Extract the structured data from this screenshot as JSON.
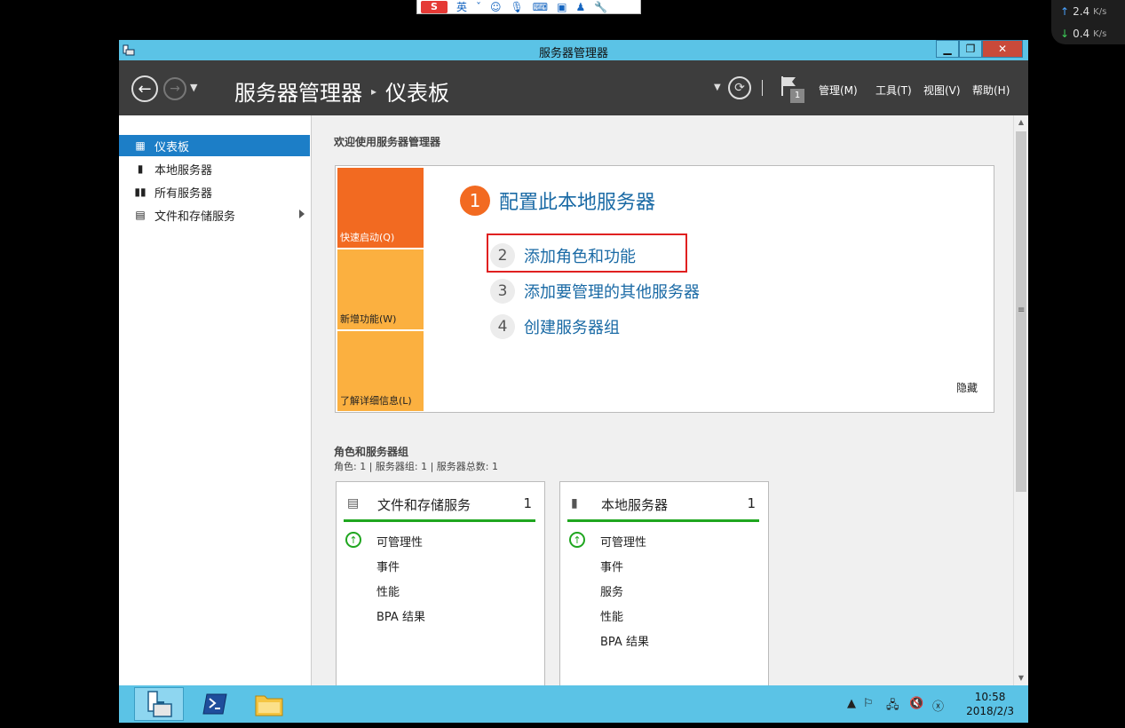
{
  "ime": {
    "label": "英",
    "logo": "S"
  },
  "netspeed": {
    "up_value": "2.4",
    "down_value": "0.4",
    "unit": "K/s"
  },
  "window": {
    "title": "服务器管理器"
  },
  "header": {
    "breadcrumb_root": "服务器管理器",
    "breadcrumb_current": "仪表板",
    "notification_count": "1",
    "menu": {
      "manage": "管理(M)",
      "tools": "工具(T)",
      "view": "视图(V)",
      "help": "帮助(H)"
    }
  },
  "sidebar": {
    "items": [
      {
        "label": "仪表板",
        "icon": "dashboard-icon"
      },
      {
        "label": "本地服务器",
        "icon": "server-icon"
      },
      {
        "label": "所有服务器",
        "icon": "servers-icon"
      },
      {
        "label": "文件和存储服务",
        "icon": "storage-icon"
      }
    ]
  },
  "welcome": {
    "title": "欢迎使用服务器管理器",
    "tiles": {
      "quickstart": "快速启动(Q)",
      "whatsnew": "新增功能(W)",
      "learnmore": "了解详细信息(L)"
    },
    "step1": {
      "num": "1",
      "label": "配置此本地服务器"
    },
    "step2": {
      "num": "2",
      "label": "添加角色和功能"
    },
    "step3": {
      "num": "3",
      "label": "添加要管理的其他服务器"
    },
    "step4": {
      "num": "4",
      "label": "创建服务器组"
    },
    "hide": "隐藏"
  },
  "roles": {
    "title": "角色和服务器组",
    "summary": "角色: 1 | 服务器组: 1 | 服务器总数: 1",
    "cards": [
      {
        "name": "文件和存储服务",
        "count": "1",
        "rows": [
          "可管理性",
          "事件",
          "性能",
          "BPA 结果"
        ]
      },
      {
        "name": "本地服务器",
        "count": "1",
        "rows": [
          "可管理性",
          "事件",
          "服务",
          "性能",
          "BPA 结果"
        ]
      }
    ]
  },
  "taskbar": {
    "time": "10:58",
    "date": "2018/2/3"
  },
  "colors": {
    "accent": "#1c7ec7",
    "orange": "#f26a21",
    "amber": "#fbb040",
    "ok_green": "#1fa61f",
    "titlebar": "#5bc3e6"
  }
}
